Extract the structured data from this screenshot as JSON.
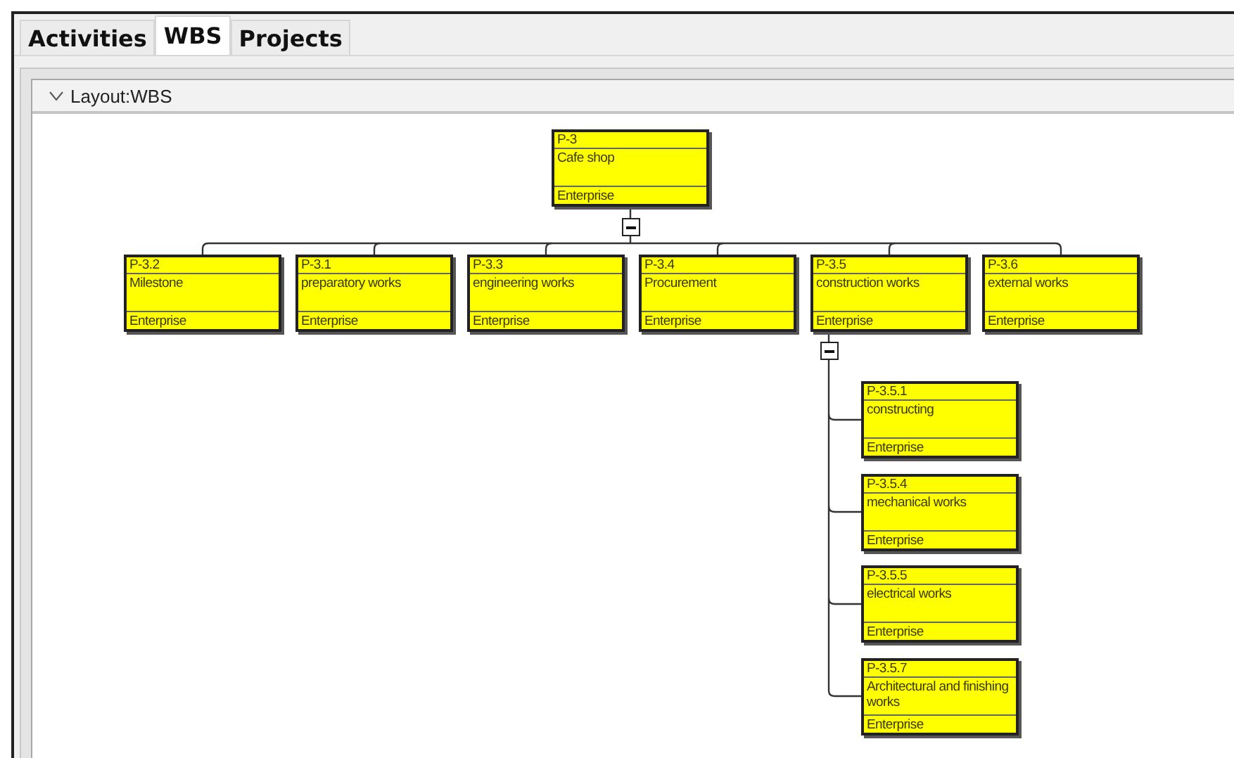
{
  "tabs": [
    {
      "label": "Activities",
      "selected": false
    },
    {
      "label": "WBS",
      "selected": true
    },
    {
      "label": "Projects",
      "selected": false
    }
  ],
  "layout_panel": {
    "title": "Layout:WBS",
    "expanded": true
  },
  "wbs": {
    "code": "P-3",
    "name": "Cafe shop",
    "owner": "Enterprise",
    "expanded": true,
    "children": [
      {
        "code": "P-3.2",
        "name": "Milestone",
        "owner": "Enterprise"
      },
      {
        "code": "P-3.1",
        "name": "preparatory works",
        "owner": "Enterprise"
      },
      {
        "code": "P-3.3",
        "name": "engineering works",
        "owner": "Enterprise"
      },
      {
        "code": "P-3.4",
        "name": "Procurement",
        "owner": "Enterprise"
      },
      {
        "code": "P-3.5",
        "name": "construction works",
        "owner": "Enterprise",
        "expanded": true,
        "children": [
          {
            "code": "P-3.5.1",
            "name": "constructing",
            "owner": "Enterprise"
          },
          {
            "code": "P-3.5.4",
            "name": "mechanical works",
            "owner": "Enterprise"
          },
          {
            "code": "P-3.5.5",
            "name": "electrical works",
            "owner": "Enterprise"
          },
          {
            "code": "P-3.5.7",
            "name": "Architectural and finishing works",
            "owner": "Enterprise"
          }
        ]
      },
      {
        "code": "P-3.6",
        "name": "external works",
        "owner": "Enterprise"
      }
    ]
  }
}
